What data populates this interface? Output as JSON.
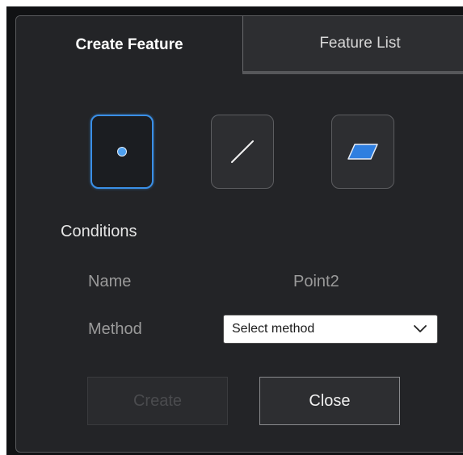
{
  "tabs": [
    {
      "label": "Create Feature",
      "active": true
    },
    {
      "label": "Feature List",
      "active": false
    }
  ],
  "feature_types": [
    {
      "icon": "point-icon",
      "selected": true
    },
    {
      "icon": "line-icon",
      "selected": false
    },
    {
      "icon": "plane-icon",
      "selected": false
    }
  ],
  "conditions": {
    "title": "Conditions",
    "name_label": "Name",
    "name_value": "Point2",
    "method_label": "Method",
    "method_selected": "Select method"
  },
  "actions": {
    "create_label": "Create",
    "close_label": "Close"
  },
  "colors": {
    "accent": "#3a8fe6",
    "background": "#232427",
    "text_primary": "#ffffff",
    "text_muted": "#9a9a9a"
  }
}
